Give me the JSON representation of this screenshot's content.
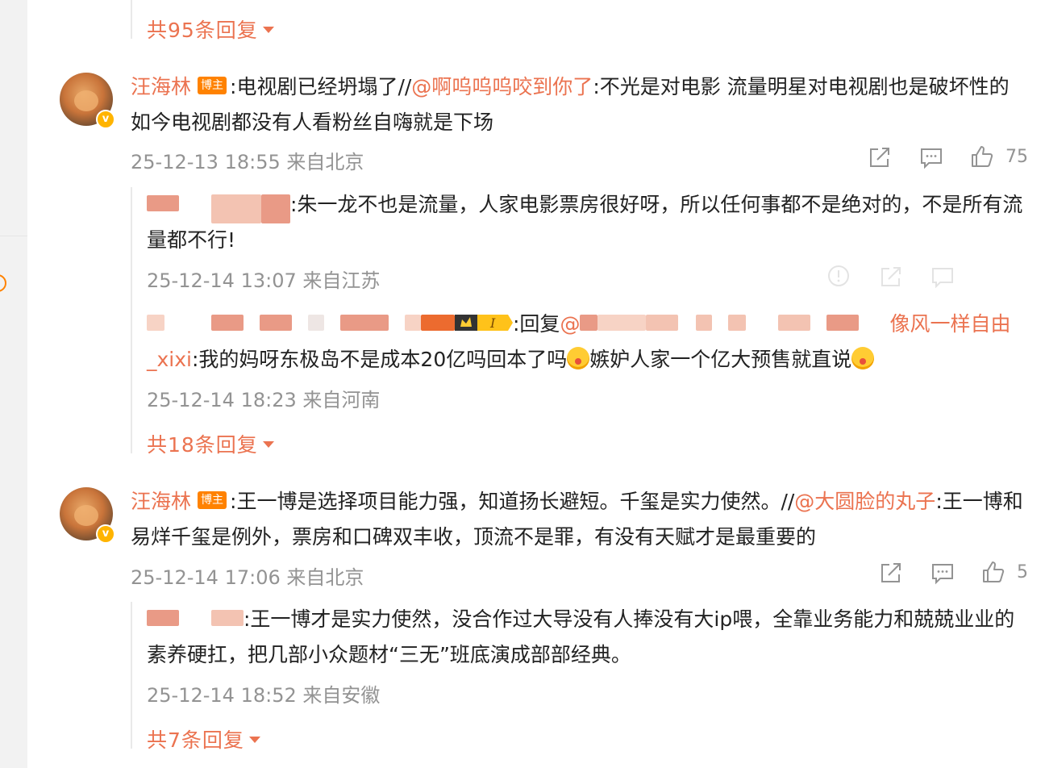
{
  "more_top": "共95条回复",
  "c1": {
    "username": "汪海林",
    "tag": "博主",
    "text_a": ":电视剧已经坍塌了//",
    "mention": "@啊呜呜呜咬到你了",
    "text_b": ":不光是对电影  流量明星对电视剧也是破坏性的 如今电视剧都没有人看粉丝自嗨就是下场",
    "meta": "25-12-13 18:55 来自北京",
    "likes": "75"
  },
  "r1": {
    "text": ":朱一龙不也是流量，人家电影票房很好呀，所以任何事都不是绝对的，不是所有流量都不行!",
    "meta": "25-12-14 13:07 来自江苏"
  },
  "r2": {
    "text_a": ":回复",
    "mention_at": "@",
    "mention_end": "像风一样自由_xixi",
    "text_b": ":我的妈呀东极岛不是成本20亿吗回本了吗",
    "text_c": "嫉妒人家一个亿大预售就直说",
    "meta": "25-12-14 18:23 来自河南"
  },
  "more_mid": "共18条回复",
  "c2": {
    "username": "汪海林",
    "tag": "博主",
    "text_a": ":王一博是选择项目能力强，知道扬长避短。千玺是实力使然。//",
    "mention": "@大圆脸的丸子",
    "text_b": ":王一博和易烊千玺是例外，票房和口碑双丰收，顶流不是罪，有没有天赋才是最重要的",
    "meta": "25-12-14 17:06 来自北京",
    "likes": "5"
  },
  "r3": {
    "text": ":王一博才是实力使然，没合作过大导没有人捧没有大ip喂，全靠业务能力和兢兢业业的素养硬扛，把几部小众题材“三无”班底演成部部经典。",
    "meta": "25-12-14 18:52 来自安徽"
  },
  "more_bottom": "共7条回复",
  "colors": {
    "accent": "#eb7350",
    "meta": "#939393",
    "tag_bg": "#ff8200"
  }
}
